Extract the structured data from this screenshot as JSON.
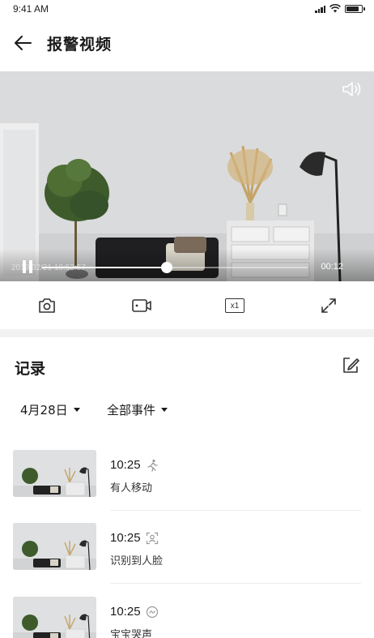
{
  "status_bar": {
    "time": "9:41 AM",
    "battery_level": 0.85
  },
  "header": {
    "title": "报警视频",
    "back_icon": "arrow-left-icon"
  },
  "video": {
    "timestamp": "2019/02/21 18:53:57",
    "duration": "00:12",
    "progress": 0.47,
    "state": "playing",
    "mute_icon": "speaker-icon"
  },
  "toolbar": {
    "items": [
      "camera-icon",
      "record-video-icon",
      "speed-icon",
      "fullscreen-icon"
    ],
    "speed_label": "x1"
  },
  "records": {
    "title": "记录",
    "edit_icon": "edit-icon",
    "date_filter": "4月28日",
    "event_filter": "全部事件",
    "items": [
      {
        "time": "10:25",
        "event": "有人移动",
        "icon": "person-motion-icon"
      },
      {
        "time": "10:25",
        "event": "识别到人脸",
        "icon": "face-detect-icon"
      },
      {
        "time": "10:25",
        "event": "宝宝哭声",
        "icon": "sound-icon"
      }
    ]
  },
  "colors": {
    "text_primary": "#1a1a1a",
    "icon_gray": "#999999",
    "band": "#f2f2f2"
  }
}
